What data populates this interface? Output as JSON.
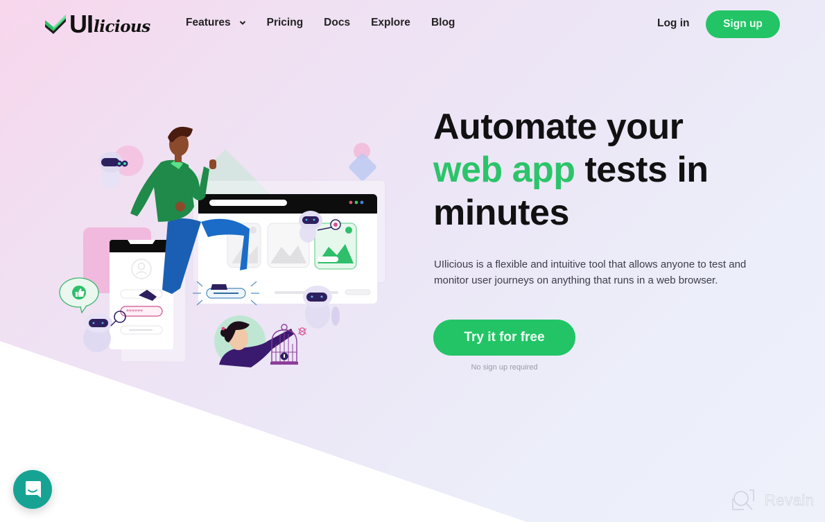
{
  "brand": {
    "name_ui": "UI",
    "name_licious": "licious",
    "accent_color": "#23c466",
    "chat_color": "#17a394"
  },
  "nav": {
    "links": [
      {
        "label": "Features",
        "has_dropdown": true
      },
      {
        "label": "Pricing"
      },
      {
        "label": "Docs"
      },
      {
        "label": "Explore"
      },
      {
        "label": "Blog"
      }
    ],
    "login_label": "Log in",
    "signup_label": "Sign up"
  },
  "hero": {
    "headline_line1": "Automate your",
    "headline_accent": "web app",
    "headline_line2_rest": " tests in",
    "headline_line3": "minutes",
    "description": "UIlicious is a flexible and intuitive tool that allows anyone to test and monitor user journeys on anything that runs in a web browser.",
    "cta_label": "Try it for free",
    "cta_note": "No sign up required"
  },
  "illustration": {
    "login_password_mask": "******",
    "icons": [
      "robot-icon",
      "thumbs-up-icon",
      "magnifier-icon",
      "bug-icon",
      "cage-icon",
      "user-avatar-icon"
    ]
  },
  "widgets": {
    "chat_icon": "chat-bubble-smile-icon",
    "watermark_text": "Revain"
  }
}
